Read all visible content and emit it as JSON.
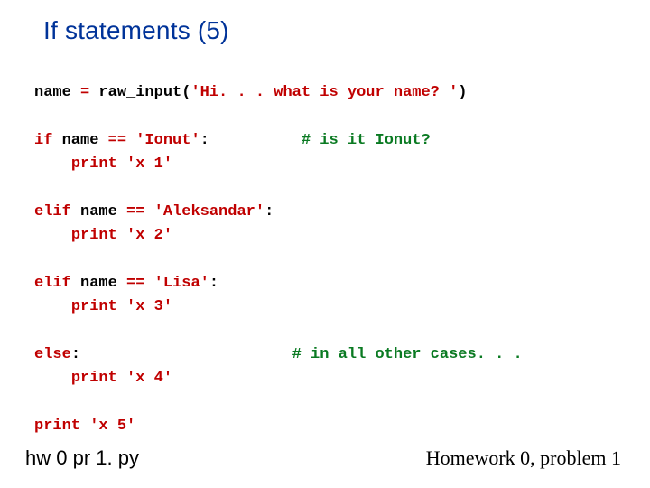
{
  "title": "If statements (5)",
  "code": {
    "line1a": "name ",
    "line1b": "=",
    "line1c": " raw_input(",
    "line1d": "'Hi. . . what is your name? '",
    "line1e": ")",
    "blank": "",
    "line2a": "if",
    "line2b": " name ",
    "line2c": "==",
    "line2d": " ",
    "line2e": "'Ionut'",
    "line2f": ":          ",
    "line2g": "# is it Ionut?",
    "line3a": "    ",
    "line3b": "print",
    "line3c": " ",
    "line3d": "'x 1'",
    "line4a": "elif",
    "line4b": " name ",
    "line4c": "==",
    "line4d": " ",
    "line4e": "'Aleksandar'",
    "line4f": ":",
    "line5a": "    ",
    "line5b": "print",
    "line5c": " ",
    "line5d": "'x 2'",
    "line6a": "elif",
    "line6b": " name ",
    "line6c": "==",
    "line6d": " ",
    "line6e": "'Lisa'",
    "line6f": ":",
    "line7a": "    ",
    "line7b": "print",
    "line7c": " ",
    "line7d": "'x 3'",
    "line8a": "else",
    "line8b": ":                       ",
    "line8c": "# in all other cases. . .",
    "line9a": "    ",
    "line9b": "print",
    "line9c": " ",
    "line9d": "'x 4'",
    "line10a": "print",
    "line10b": " ",
    "line10c": "'x 5'"
  },
  "filename": "hw 0 pr 1. py",
  "footer": "Homework 0, problem 1"
}
